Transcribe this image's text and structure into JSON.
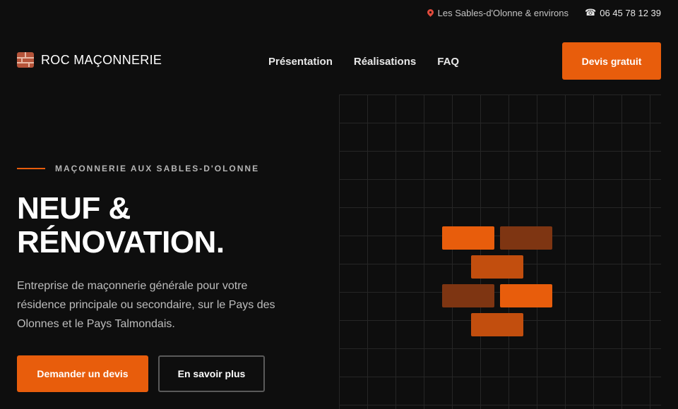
{
  "topbar": {
    "location": "Les Sables-d'Olonne & environs",
    "phone": "06 45 78 12 39"
  },
  "header": {
    "brand": "ROC MAÇONNERIE",
    "nav": [
      "Présentation",
      "Réalisations",
      "FAQ"
    ],
    "cta": "Devis gratuit"
  },
  "hero": {
    "eyebrow": "MAÇONNERIE AUX SABLES-D'OLONNE",
    "headline_line1": "NEUF &",
    "headline_line2": "RÉNOVATION.",
    "description": "Entreprise de maçonnerie générale pour votre résidence principale ou secondaire, sur le Pays des Olonnes et le Pays Talmondais.",
    "primary_button": "Demander un devis",
    "secondary_button": "En savoir plus"
  },
  "colors": {
    "accent": "#e85d0c",
    "background": "#0e0e0e",
    "brick_mid": "#c24e0e",
    "brick_dark": "#7e3512"
  }
}
